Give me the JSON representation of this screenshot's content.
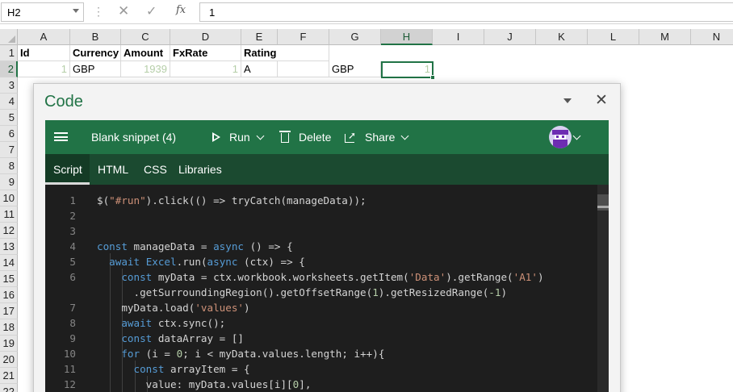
{
  "formula_bar": {
    "name_box": "H2",
    "cancel_glyph": "✕",
    "enter_glyph": "✓",
    "fx_label": "fx",
    "formula_value": "1"
  },
  "sheet": {
    "columns": [
      "A",
      "B",
      "C",
      "D",
      "E",
      "F",
      "G",
      "H",
      "I",
      "J",
      "K",
      "L",
      "M",
      "N"
    ],
    "selected_column": "H",
    "rows": [
      "1",
      "2",
      "3",
      "4",
      "5",
      "6",
      "7",
      "8",
      "9",
      "10",
      "11",
      "12",
      "13",
      "14",
      "15",
      "16",
      "17",
      "18",
      "19",
      "20",
      "21",
      "22"
    ],
    "selected_row": "2",
    "headers": {
      "A1": "Id",
      "B1": "Currency",
      "C1": "Amount",
      "D1": "FxRate",
      "E1": "Rating"
    },
    "values": {
      "A2": "1",
      "B2": "GBP",
      "C2": "1939",
      "D2": "1",
      "E2": "A",
      "G2": "GBP",
      "H2": "1"
    }
  },
  "code_pane": {
    "title": "Code",
    "close_glyph": "✕",
    "toolbar": {
      "snippet_name": "Blank snippet (4)",
      "run_label": "Run",
      "delete_label": "Delete",
      "share_label": "Share"
    },
    "tabs": [
      "Script",
      "HTML",
      "CSS",
      "Libraries"
    ],
    "active_tab": "Script",
    "editor": {
      "line_numbers": [
        "1",
        "2",
        "3",
        "4",
        "5",
        "6",
        "",
        "7",
        "8",
        "9",
        "10",
        "11",
        "12"
      ],
      "lines": [
        "$(\"#run\").click(() => tryCatch(manageData));",
        "",
        "",
        "const manageData = async () => {",
        "  await Excel.run(async (ctx) => {",
        "    const myData = ctx.workbook.worksheets.getItem('Data').getRange('A1')",
        "      .getSurroundingRegion().getOffsetRange(1).getResizedRange(-1)",
        "    myData.load('values')",
        "    await ctx.sync();",
        "    const dataArray = []",
        "    for (i = 0; i < myData.values.length; i++){",
        "      const arrayItem = {",
        "        value: myData.values[i][0],"
      ]
    }
  },
  "colors": {
    "excel_green": "#217346",
    "tab_bar": "#1b4a30",
    "editor_bg": "#1e1e1e",
    "keyword": "#569cd6",
    "string": "#ce9178",
    "number": "#b5cea8"
  }
}
